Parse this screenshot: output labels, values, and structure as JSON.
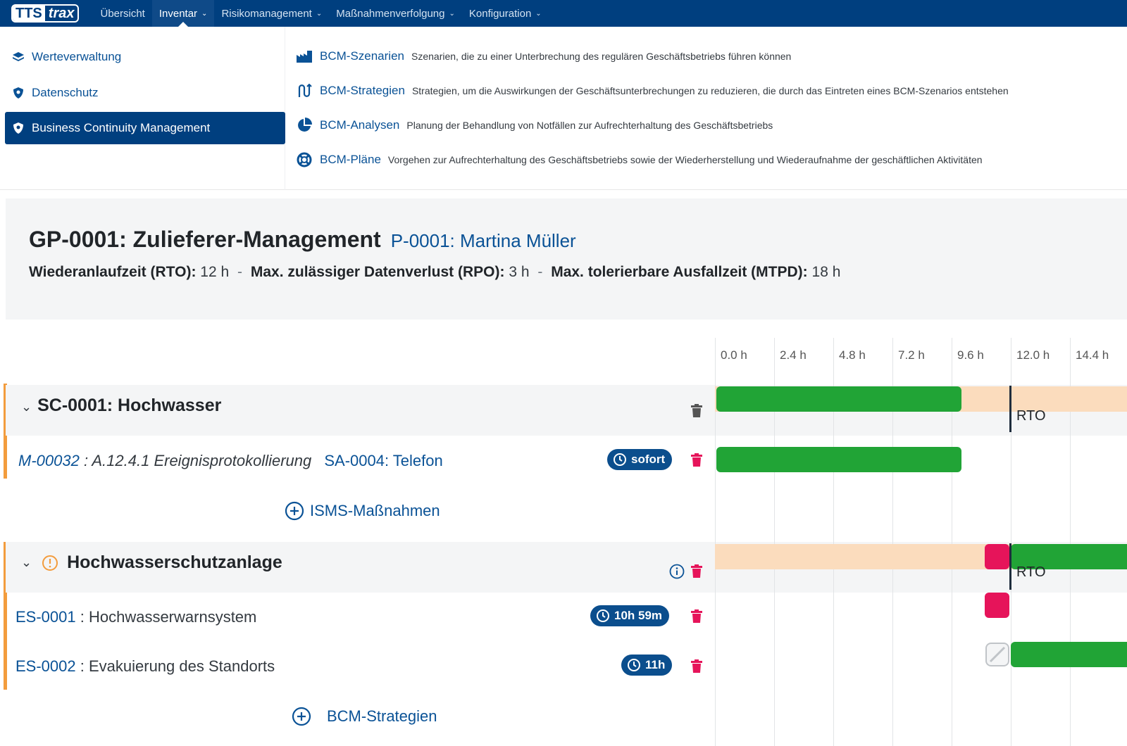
{
  "nav": {
    "logo_left": "TTS",
    "logo_right": "trax",
    "items": [
      {
        "label": "Übersicht"
      },
      {
        "label": "Inventar"
      },
      {
        "label": "Risikomanagement"
      },
      {
        "label": "Maßnahmenverfolgung"
      },
      {
        "label": "Konfiguration"
      }
    ]
  },
  "mega_menu": {
    "left": [
      {
        "label": "Werteverwaltung",
        "icon": "layers-icon"
      },
      {
        "label": "Datenschutz",
        "icon": "shield-icon"
      },
      {
        "label": "Business Continuity Management",
        "icon": "shield-icon"
      }
    ],
    "right": [
      {
        "title": "BCM-Szenarien",
        "desc": "Szenarien, die zu einer Unterbrechung des regulären Geschäftsbetriebs führen können",
        "icon": "factory-icon"
      },
      {
        "title": "BCM-Strategien",
        "desc": "Strategien, um die Auswirkungen der Geschäftsunterbrechungen zu reduzieren, die durch das Eintreten eines BCM-Szenarios entstehen",
        "icon": "route-icon"
      },
      {
        "title": "BCM-Analysen",
        "desc": "Planung der Behandlung von Notfällen zur Aufrechterhaltung des Geschäftsbetriebs",
        "icon": "pie-chart-icon"
      },
      {
        "title": "BCM-Pläne",
        "desc": "Vorgehen zur Aufrechterhaltung des Geschäftsbetriebs sowie der Wiederherstellung und Wiederaufnahme der geschäftlichen Aktivitäten",
        "icon": "lifebuoy-icon"
      }
    ]
  },
  "header": {
    "title": "GP-0001: Zulieferer-Management",
    "owner": "P-0001: Martina Müller",
    "rto_label": "Wiederanlaufzeit (RTO):",
    "rto_value": "12 h",
    "rpo_label": "Max. zulässiger Datenverlust (RPO):",
    "rpo_value": "3 h",
    "mtpd_label": "Max. tolerierbare Ausfallzeit (MTPD):",
    "mtpd_value": "18 h",
    "separator": "-"
  },
  "groups": [
    {
      "title": "SC-0001: Hochwasser",
      "rows": [
        {
          "id": "M-00032",
          "sep": " : ",
          "name": "A.12.4.1 Ereignisprotokollierung",
          "extra": "SA-0004: Telefon",
          "badge": "sofort"
        }
      ],
      "add_label": "ISMS-Maßnahmen"
    },
    {
      "title": "Hochwasserschutzanlage",
      "rows": [
        {
          "id": "ES-0001",
          "sep": " : ",
          "name": "Hochwasserwarnsystem",
          "badge": "10h 59m"
        },
        {
          "id": "ES-0002",
          "sep": " : ",
          "name": "Evakuierung des Standorts",
          "badge": "11h"
        }
      ],
      "add_label": "BCM-Strategien"
    }
  ],
  "timeline": {
    "ticks": [
      "0.0 h",
      "2.4 h",
      "4.8 h",
      "7.2 h",
      "9.6 h",
      "12.0 h",
      "14.4 h"
    ],
    "rto_label": "RTO",
    "colors": {
      "green": "#21a436",
      "peach": "#fbdcbd",
      "pink": "#e6145a",
      "navy": "#003f7f"
    }
  }
}
